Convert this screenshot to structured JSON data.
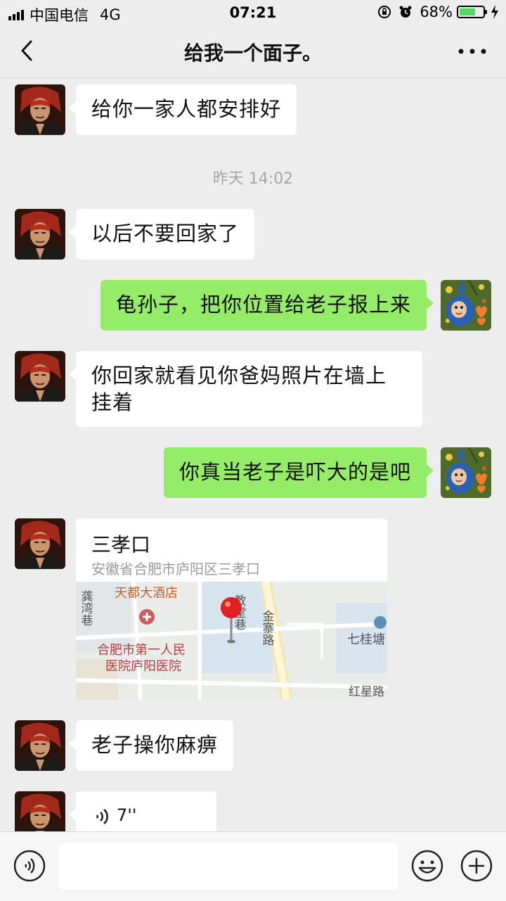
{
  "status_bar": {
    "carrier": "中国电信",
    "network": "4G",
    "time": "07:21",
    "battery_percent": "68%",
    "battery_level": 0.68
  },
  "header": {
    "title": "给我一个面子。",
    "back_icon": "chevron-left-icon",
    "more_icon": "ellipsis-icon"
  },
  "messages": [
    {
      "side": "in",
      "text": "给你一家人都安排好"
    },
    {
      "type": "time",
      "text": "昨天 14:02"
    },
    {
      "side": "in",
      "text": "以后不要回家了"
    },
    {
      "side": "out",
      "text": "龟孙子，把你位置给老子报上来"
    },
    {
      "side": "in",
      "text": "你回家就看见你爸妈照片在墙上挂着"
    },
    {
      "side": "out",
      "text": "你真当老子是吓大的是吧"
    },
    {
      "side": "in",
      "type": "location",
      "name": "三孝口",
      "address": "安徽省合肥市庐阳区三孝口",
      "map_labels": {
        "hotel": "天都大酒店",
        "lane1": "龚湾巷",
        "lane2": "教堂巷",
        "road1": "金寨路",
        "hospital_line1": "合肥市第一人民",
        "hospital_line2": "医院庐阳医院",
        "area": "七桂塘",
        "road2": "红星路"
      }
    },
    {
      "side": "in",
      "text": "老子操你麻痹"
    },
    {
      "side": "in",
      "type": "voice",
      "duration": "7''"
    }
  ],
  "input_bar": {
    "voice_icon": "voice-mode-icon",
    "emoji_icon": "emoji-icon",
    "plus_icon": "plus-icon",
    "placeholder": ""
  },
  "colors": {
    "background": "#ededed",
    "outgoing_bubble": "#95ec69",
    "incoming_bubble": "#ffffff",
    "battery_fill": "#4cd964"
  }
}
